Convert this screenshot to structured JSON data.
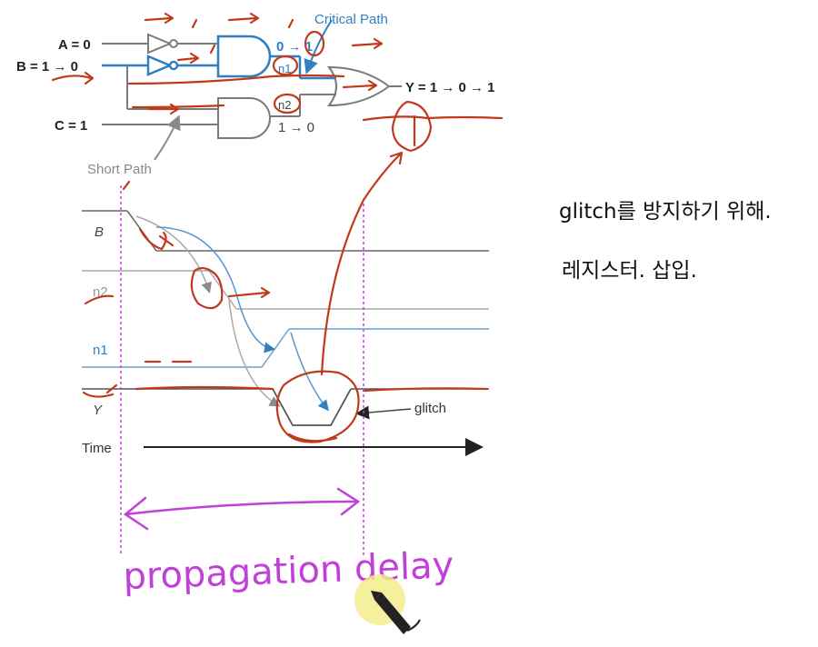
{
  "circuit": {
    "input_a": "A = 0",
    "input_b": "B = 1 → 0",
    "input_c": "C = 1",
    "critical_path": "Critical Path",
    "short_path": "Short Path",
    "n1_value": "0 → 1",
    "n1_label": "n1",
    "n2_label": "n2",
    "n2_value": "1 → 0",
    "output": "Y = 1 → 0 → 1"
  },
  "timing": {
    "signal_b": "B",
    "signal_n2": "n2",
    "signal_n1": "n1",
    "signal_y": "Y",
    "glitch": "glitch",
    "time_axis": "Time"
  },
  "annotations": {
    "delay_label": "propagation delay",
    "note_line1": "glitch를 방지하기 위해.",
    "note_line2": "레지스터. 삽입."
  },
  "colors": {
    "ink_red": "#c0391b",
    "ink_purple": "#c040d8",
    "circuit_blue": "#2f7fc1",
    "circuit_gray": "#7a7a7a"
  },
  "icons": [
    "pen-cursor-icon"
  ]
}
